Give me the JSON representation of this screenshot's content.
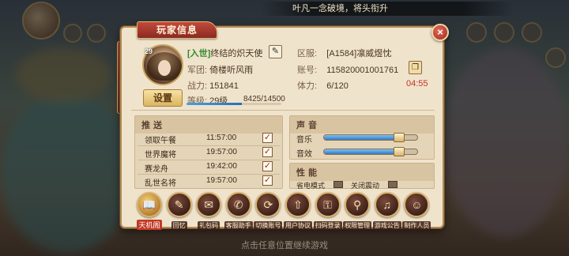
{
  "background": {
    "ticker_text": "叶凡一念破境，将头衔升",
    "bottom_hint": "点击任意位置继续游戏"
  },
  "panel": {
    "title": "玩家信息",
    "close_glyph": "×"
  },
  "player": {
    "avatar_level": "29",
    "tag": "[入世]",
    "name": "终结的炽天使",
    "legion_label": "军团:",
    "legion_value": "倚楼听风雨",
    "power_label": "战力:",
    "power_value": "151841",
    "level_label": "等级:",
    "level_value": "29级",
    "exp_text": "8425/14500",
    "exp_fraction": 0.581,
    "server_label": "区服:",
    "server_value": "[A1584]凛威煜忱",
    "account_label": "账号:",
    "account_value": "115820001001761",
    "stamina_label": "体力:",
    "stamina_value": "6/120",
    "stamina_timer": "04:55",
    "settings_button": "设置"
  },
  "push": {
    "title": "推送",
    "rows": [
      {
        "name": "领取午餐",
        "time": "11:57:00",
        "checked": true
      },
      {
        "name": "世界魔将",
        "time": "19:57:00",
        "checked": true
      },
      {
        "name": "赛龙舟",
        "time": "19:42:00",
        "checked": true
      },
      {
        "name": "乱世名将",
        "time": "19:57:00",
        "checked": true
      }
    ]
  },
  "sound": {
    "title": "声音",
    "music_label": "音乐",
    "music_level": 0.8,
    "sfx_label": "音效",
    "sfx_level": 0.8
  },
  "performance": {
    "title": "性能",
    "power_saving_label": "省电模式",
    "vibration_label": "关闭震动"
  },
  "toolbar": [
    {
      "label": "天机阁",
      "glyph": "📖",
      "active": true
    },
    {
      "label": "回忆",
      "glyph": "✎",
      "active": false
    },
    {
      "label": "礼包码",
      "glyph": "✉",
      "active": false
    },
    {
      "label": "客服助手",
      "glyph": "✆",
      "active": false
    },
    {
      "label": "切换账号",
      "glyph": "⟳",
      "active": false
    },
    {
      "label": "用户协议",
      "glyph": "⇧",
      "active": false
    },
    {
      "label": "扫码登录",
      "glyph": "⚿",
      "active": false
    },
    {
      "label": "权限管理",
      "glyph": "⚲",
      "active": false
    },
    {
      "label": "游戏公告",
      "glyph": "♫",
      "active": false
    },
    {
      "label": "制作人员",
      "glyph": "☺",
      "active": false
    }
  ]
}
